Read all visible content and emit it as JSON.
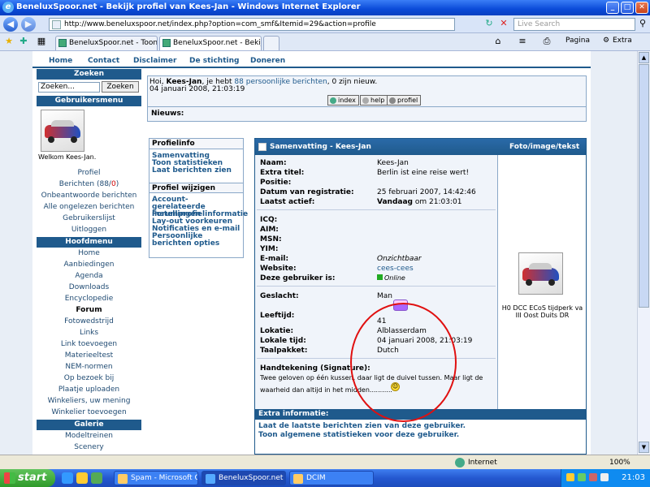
{
  "window": {
    "title": "BeneluxSpoor.net - Bekijk profiel van Kees-Jan - Windows Internet Explorer"
  },
  "address": {
    "url": "http://www.beneluxspoor.net/index.php?option=com_smf&Itemid=29&action=profile",
    "search_placeholder": "Live Search"
  },
  "tabs": [
    {
      "label": "BeneluxSpoor.net - Toon hie..."
    },
    {
      "label": "BeneluxSpoor.net - Bekijk..."
    }
  ],
  "toolbar_right": {
    "page": "Pagina",
    "extra": "Extra"
  },
  "topnav": [
    "Home",
    "Contact",
    "Disclaimer",
    "De stichting",
    "Doneren"
  ],
  "sidebar": {
    "search_head": "Zoeken",
    "search_value": "Zoeken...",
    "search_button": "Zoeken",
    "user_menu_head": "Gebruikersmenu",
    "welcome": "Welkom Kees-Jan.",
    "user_items": [
      "Profiel",
      "Onbeantwoorde berichten",
      "Alle ongelezen berichten",
      "Gebruikerslijst",
      "Uitloggen"
    ],
    "berichten_label": "Berichten (88/",
    "berichten_unread": "0",
    "berichten_close": ")",
    "main_menu_head": "Hoofdmenu",
    "main_items": [
      "Home",
      "Aanbiedingen",
      "Agenda",
      "Downloads",
      "Encyclopedie",
      "Forum",
      "Fotowedstrijd",
      "Links",
      "Link toevoegen",
      "Materieeltest",
      "NEM-normen",
      "Op bezoek bij",
      "Plaatje uploaden",
      "Winkeliers, uw mening",
      "Winkelier toevoegen"
    ],
    "gallery_head": "Galerie",
    "gallery_items": [
      "Modeltreinen",
      "Scenery"
    ]
  },
  "info": {
    "greeting_pre": "Hoi, ",
    "user": "Kees-Jan",
    "greeting_mid": ", je hebt ",
    "messages_link": "88 persoonlijke berichten",
    "greeting_post": ", 0 zijn nieuw.",
    "date": "04 januari 2008, 21:03:19",
    "buttons": [
      "index",
      "help",
      "profiel"
    ],
    "nieuws": "Nieuws:"
  },
  "profile_menu": {
    "info_head": "Profielinfo",
    "info_links": [
      "Samenvatting",
      "Toon statistieken",
      "Laat berichten zien"
    ],
    "edit_head": "Profiel wijzigen",
    "edit_links": [
      "Account-gerelateerde instellingen",
      "Forumprofielinformatie",
      "Lay-out voorkeuren",
      "Notificaties en e-mail",
      "Persoonlijke berichten opties"
    ]
  },
  "summary": {
    "title": "Samenvatting - Kees-Jan",
    "photo_title": "Foto/image/tekst",
    "fields": {
      "naam_l": "Naam:",
      "naam_v": "Kees-Jan",
      "titel_l": "Extra titel:",
      "titel_v": "Berlin ist eine reise wert!",
      "positie_l": "Positie:",
      "reg_l": "Datum van registratie:",
      "reg_v": "25 februari 2007, 14:42:46",
      "actief_l": "Laatst actief:",
      "actief_v1": "Vandaag",
      "actief_v2": " om 21:03:01",
      "icq_l": "ICQ:",
      "aim_l": "AIM:",
      "msn_l": "MSN:",
      "yim_l": "YIM:",
      "email_l": "E-mail:",
      "email_v": "Onzichtbaar",
      "web_l": "Website:",
      "web_v": "cees-cees",
      "online_l": "Deze gebruiker is:",
      "online_v": "Online",
      "geslacht_l": "Geslacht:",
      "geslacht_v": "Man",
      "leeftijd_l": "Leeftijd:",
      "leeftijd_v": "41",
      "lokatie_l": "Lokatie:",
      "lokatie_v": "Alblasserdam",
      "tijd_l": "Lokale tijd:",
      "tijd_v": "04 januari 2008, 21:03:19",
      "taal_l": "Taalpakket:",
      "taal_v": "Dutch",
      "sig_l": "Handtekening (Signature):",
      "sig_v1": "Twee geloven op één kussen, daar ligt de duivel tussen. Maar ligt de",
      "sig_v2": "waarheid dan altijd in het midden..........."
    },
    "photo_caption": "H0 DCC ECoS tijdperk va III Oost Duits DR",
    "extra_head": "Extra informatie:",
    "extra_links": [
      "Laat de laatste berichten zien van deze gebruiker.",
      "Toon algemene statistieken voor deze gebruiker."
    ]
  },
  "status": {
    "zone": "Internet",
    "zoom": "100%"
  },
  "taskbar": {
    "start": "start",
    "tasks": [
      "Spam - Microsoft Outl...",
      "BeneluxSpoor.net - B...",
      "DCIM"
    ],
    "clock": "21:03"
  },
  "colors": {
    "nav_blue": "#1f5a8c",
    "annotation_red": "#e01010"
  }
}
